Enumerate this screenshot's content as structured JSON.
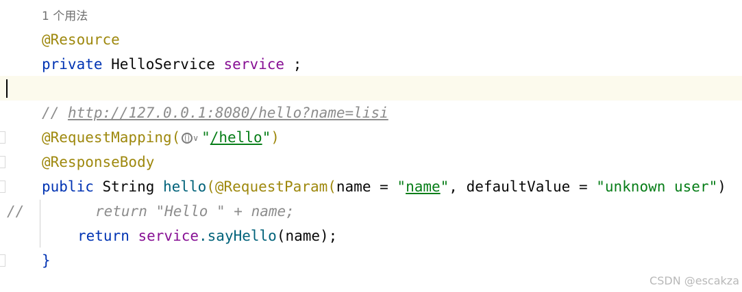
{
  "editor": {
    "usage_hint": "1 个用法",
    "line_resource": "@Resource",
    "line_private": {
      "kw": "private",
      "type": " HelloService ",
      "field": "service",
      "end": " ;"
    },
    "line_comment": {
      "prefix": "// ",
      "url": "http://127.0.0.1:8080/hello?name=lisi"
    },
    "line_request_mapping": {
      "ann": "@RequestMapping(",
      "str_open": "\"",
      "path": "/hello",
      "str_close": "\"",
      "end": ")"
    },
    "line_response_body": "@ResponseBody",
    "line_method": {
      "kw": "public",
      "type": " String ",
      "name": "hello",
      "ann": "(@RequestParam(",
      "p1": "name = ",
      "s1_open": "\"",
      "s1_val": "name",
      "s1_close": "\"",
      "p2": ", defaultValue = ",
      "s2": "\"unknown user\"",
      "end": ")"
    },
    "line_commented_return": {
      "gutter": "//",
      "text": "return \"Hello \" + name;"
    },
    "line_return": {
      "kw": "return",
      "field": " service",
      "call": ".sayHello",
      "args": "(name);"
    },
    "line_close": "}"
  },
  "watermark": "CSDN @escakza"
}
